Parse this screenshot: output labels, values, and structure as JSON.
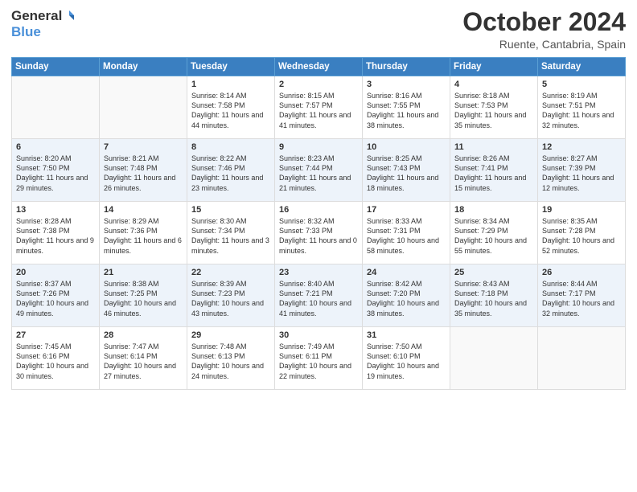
{
  "header": {
    "logo_general": "General",
    "logo_blue": "Blue",
    "month": "October 2024",
    "location": "Ruente, Cantabria, Spain"
  },
  "days_of_week": [
    "Sunday",
    "Monday",
    "Tuesday",
    "Wednesday",
    "Thursday",
    "Friday",
    "Saturday"
  ],
  "weeks": [
    [
      {
        "day": "",
        "sunrise": "",
        "sunset": "",
        "daylight": ""
      },
      {
        "day": "",
        "sunrise": "",
        "sunset": "",
        "daylight": ""
      },
      {
        "day": "1",
        "sunrise": "Sunrise: 8:14 AM",
        "sunset": "Sunset: 7:58 PM",
        "daylight": "Daylight: 11 hours and 44 minutes."
      },
      {
        "day": "2",
        "sunrise": "Sunrise: 8:15 AM",
        "sunset": "Sunset: 7:57 PM",
        "daylight": "Daylight: 11 hours and 41 minutes."
      },
      {
        "day": "3",
        "sunrise": "Sunrise: 8:16 AM",
        "sunset": "Sunset: 7:55 PM",
        "daylight": "Daylight: 11 hours and 38 minutes."
      },
      {
        "day": "4",
        "sunrise": "Sunrise: 8:18 AM",
        "sunset": "Sunset: 7:53 PM",
        "daylight": "Daylight: 11 hours and 35 minutes."
      },
      {
        "day": "5",
        "sunrise": "Sunrise: 8:19 AM",
        "sunset": "Sunset: 7:51 PM",
        "daylight": "Daylight: 11 hours and 32 minutes."
      }
    ],
    [
      {
        "day": "6",
        "sunrise": "Sunrise: 8:20 AM",
        "sunset": "Sunset: 7:50 PM",
        "daylight": "Daylight: 11 hours and 29 minutes."
      },
      {
        "day": "7",
        "sunrise": "Sunrise: 8:21 AM",
        "sunset": "Sunset: 7:48 PM",
        "daylight": "Daylight: 11 hours and 26 minutes."
      },
      {
        "day": "8",
        "sunrise": "Sunrise: 8:22 AM",
        "sunset": "Sunset: 7:46 PM",
        "daylight": "Daylight: 11 hours and 23 minutes."
      },
      {
        "day": "9",
        "sunrise": "Sunrise: 8:23 AM",
        "sunset": "Sunset: 7:44 PM",
        "daylight": "Daylight: 11 hours and 21 minutes."
      },
      {
        "day": "10",
        "sunrise": "Sunrise: 8:25 AM",
        "sunset": "Sunset: 7:43 PM",
        "daylight": "Daylight: 11 hours and 18 minutes."
      },
      {
        "day": "11",
        "sunrise": "Sunrise: 8:26 AM",
        "sunset": "Sunset: 7:41 PM",
        "daylight": "Daylight: 11 hours and 15 minutes."
      },
      {
        "day": "12",
        "sunrise": "Sunrise: 8:27 AM",
        "sunset": "Sunset: 7:39 PM",
        "daylight": "Daylight: 11 hours and 12 minutes."
      }
    ],
    [
      {
        "day": "13",
        "sunrise": "Sunrise: 8:28 AM",
        "sunset": "Sunset: 7:38 PM",
        "daylight": "Daylight: 11 hours and 9 minutes."
      },
      {
        "day": "14",
        "sunrise": "Sunrise: 8:29 AM",
        "sunset": "Sunset: 7:36 PM",
        "daylight": "Daylight: 11 hours and 6 minutes."
      },
      {
        "day": "15",
        "sunrise": "Sunrise: 8:30 AM",
        "sunset": "Sunset: 7:34 PM",
        "daylight": "Daylight: 11 hours and 3 minutes."
      },
      {
        "day": "16",
        "sunrise": "Sunrise: 8:32 AM",
        "sunset": "Sunset: 7:33 PM",
        "daylight": "Daylight: 11 hours and 0 minutes."
      },
      {
        "day": "17",
        "sunrise": "Sunrise: 8:33 AM",
        "sunset": "Sunset: 7:31 PM",
        "daylight": "Daylight: 10 hours and 58 minutes."
      },
      {
        "day": "18",
        "sunrise": "Sunrise: 8:34 AM",
        "sunset": "Sunset: 7:29 PM",
        "daylight": "Daylight: 10 hours and 55 minutes."
      },
      {
        "day": "19",
        "sunrise": "Sunrise: 8:35 AM",
        "sunset": "Sunset: 7:28 PM",
        "daylight": "Daylight: 10 hours and 52 minutes."
      }
    ],
    [
      {
        "day": "20",
        "sunrise": "Sunrise: 8:37 AM",
        "sunset": "Sunset: 7:26 PM",
        "daylight": "Daylight: 10 hours and 49 minutes."
      },
      {
        "day": "21",
        "sunrise": "Sunrise: 8:38 AM",
        "sunset": "Sunset: 7:25 PM",
        "daylight": "Daylight: 10 hours and 46 minutes."
      },
      {
        "day": "22",
        "sunrise": "Sunrise: 8:39 AM",
        "sunset": "Sunset: 7:23 PM",
        "daylight": "Daylight: 10 hours and 43 minutes."
      },
      {
        "day": "23",
        "sunrise": "Sunrise: 8:40 AM",
        "sunset": "Sunset: 7:21 PM",
        "daylight": "Daylight: 10 hours and 41 minutes."
      },
      {
        "day": "24",
        "sunrise": "Sunrise: 8:42 AM",
        "sunset": "Sunset: 7:20 PM",
        "daylight": "Daylight: 10 hours and 38 minutes."
      },
      {
        "day": "25",
        "sunrise": "Sunrise: 8:43 AM",
        "sunset": "Sunset: 7:18 PM",
        "daylight": "Daylight: 10 hours and 35 minutes."
      },
      {
        "day": "26",
        "sunrise": "Sunrise: 8:44 AM",
        "sunset": "Sunset: 7:17 PM",
        "daylight": "Daylight: 10 hours and 32 minutes."
      }
    ],
    [
      {
        "day": "27",
        "sunrise": "Sunrise: 7:45 AM",
        "sunset": "Sunset: 6:16 PM",
        "daylight": "Daylight: 10 hours and 30 minutes."
      },
      {
        "day": "28",
        "sunrise": "Sunrise: 7:47 AM",
        "sunset": "Sunset: 6:14 PM",
        "daylight": "Daylight: 10 hours and 27 minutes."
      },
      {
        "day": "29",
        "sunrise": "Sunrise: 7:48 AM",
        "sunset": "Sunset: 6:13 PM",
        "daylight": "Daylight: 10 hours and 24 minutes."
      },
      {
        "day": "30",
        "sunrise": "Sunrise: 7:49 AM",
        "sunset": "Sunset: 6:11 PM",
        "daylight": "Daylight: 10 hours and 22 minutes."
      },
      {
        "day": "31",
        "sunrise": "Sunrise: 7:50 AM",
        "sunset": "Sunset: 6:10 PM",
        "daylight": "Daylight: 10 hours and 19 minutes."
      },
      {
        "day": "",
        "sunrise": "",
        "sunset": "",
        "daylight": ""
      },
      {
        "day": "",
        "sunrise": "",
        "sunset": "",
        "daylight": ""
      }
    ]
  ]
}
